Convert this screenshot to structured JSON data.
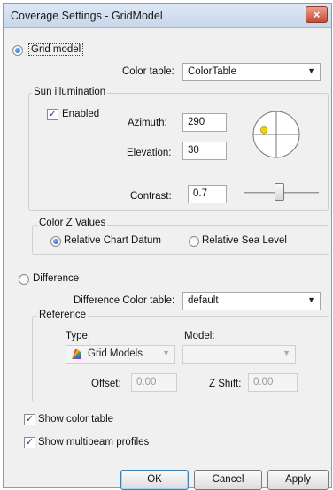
{
  "window": {
    "title": "Coverage Settings - GridModel",
    "close_glyph": "×"
  },
  "grid_model": {
    "label": "Grid model",
    "selected": true,
    "color_table_label": "Color table:",
    "color_table_value": "ColorTable",
    "sun_illumination": {
      "label": "Sun illumination",
      "enabled_label": "Enabled",
      "enabled": true,
      "azimuth_label": "Azimuth:",
      "azimuth_value": "290",
      "elevation_label": "Elevation:",
      "elevation_value": "30",
      "contrast_label": "Contrast:",
      "contrast_value": "0.7"
    },
    "color_z_values": {
      "label": "Color Z Values",
      "option_relative_chart_datum": "Relative Chart Datum",
      "option_relative_sea_level": "Relative Sea Level",
      "selected": "Relative Chart Datum"
    }
  },
  "difference": {
    "label": "Difference",
    "selected": false,
    "color_table_label": "Difference Color table:",
    "color_table_value": "default",
    "reference": {
      "label": "Reference",
      "type_label": "Type:",
      "type_value": "Grid Models",
      "model_label": "Model:",
      "model_value": "",
      "offset_label": "Offset:",
      "offset_value": "0.00",
      "zshift_label": "Z Shift:",
      "zshift_value": "0.00"
    }
  },
  "options": {
    "show_color_table": "Show color table",
    "show_color_table_checked": true,
    "show_multibeam_profiles": "Show multibeam profiles",
    "show_multibeam_profiles_checked": true
  },
  "buttons": {
    "ok": "OK",
    "cancel": "Cancel",
    "apply": "Apply"
  },
  "colors": {
    "title_bar": "#c7d6ea",
    "close_button": "#c74a33",
    "default_button_border": "#3c7fb1",
    "sun_dot": "#f2d600"
  },
  "icons": {
    "grid_models_type_icon": "color-fan-icon",
    "compass": "crosshair-circle-icon",
    "dropdown": "chevron-down-icon"
  }
}
